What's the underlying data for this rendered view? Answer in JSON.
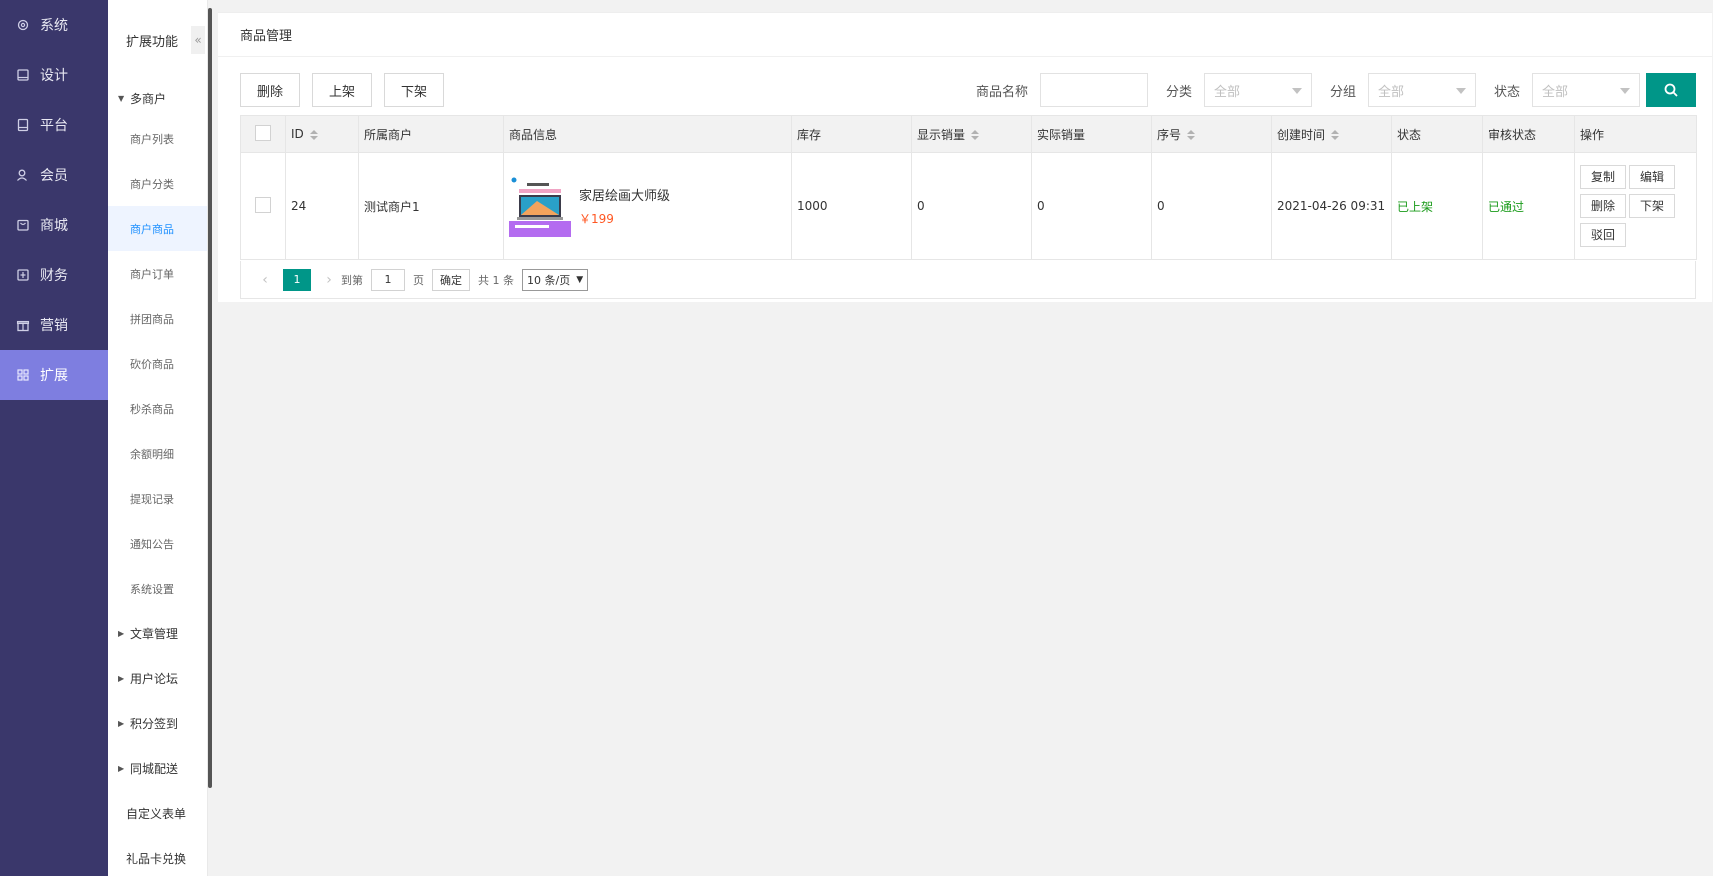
{
  "nav": {
    "items": [
      {
        "label": "系统",
        "icon": "gear-icon"
      },
      {
        "label": "设计",
        "icon": "monitor-icon"
      },
      {
        "label": "平台",
        "icon": "tablet-icon"
      },
      {
        "label": "会员",
        "icon": "user-icon"
      },
      {
        "label": "商城",
        "icon": "shop-icon"
      },
      {
        "label": "财务",
        "icon": "finance-icon"
      },
      {
        "label": "营销",
        "icon": "gift-icon"
      },
      {
        "label": "扩展",
        "icon": "grid-icon"
      }
    ],
    "active": "扩展"
  },
  "submenu": {
    "title": "扩展功能",
    "collapse_glyph": "«",
    "group_merchant": "多商户",
    "merchant_items": [
      "商户列表",
      "商户分类",
      "商户商品",
      "商户订单",
      "拼团商品",
      "砍价商品",
      "秒杀商品",
      "余额明细",
      "提现记录",
      "通知公告",
      "系统设置"
    ],
    "active_item": "商户商品",
    "groups": [
      "文章管理",
      "用户论坛",
      "积分签到",
      "同城配送"
    ],
    "plain_items": [
      "自定义表单",
      "礼品卡兑换"
    ]
  },
  "page": {
    "title": "商品管理"
  },
  "toolbar": {
    "delete_label": "删除",
    "shelve_label": "上架",
    "unshelve_label": "下架"
  },
  "filters": {
    "name_label": "商品名称",
    "name_value": "",
    "category_label": "分类",
    "category_value": "全部",
    "group_label": "分组",
    "group_value": "全部",
    "status_label": "状态",
    "status_value": "全部"
  },
  "table": {
    "headers": [
      "ID",
      "所属商户",
      "商品信息",
      "库存",
      "显示销量",
      "实际销量",
      "序号",
      "创建时间",
      "状态",
      "审核状态",
      "操作"
    ],
    "rows": [
      {
        "id": "24",
        "merchant": "测试商户1",
        "goods_name": "家居绘画大师级",
        "price": "￥199",
        "stock": "1000",
        "display_sales": "0",
        "actual_sales": "0",
        "sort": "0",
        "created": "2021-04-26 09:31",
        "status": "已上架",
        "audit": "已通过",
        "ops": [
          "复制",
          "编辑",
          "删除",
          "下架",
          "驳回"
        ]
      }
    ]
  },
  "pager": {
    "current": "1",
    "goto_label": "到第",
    "goto_value": "1",
    "page_unit": "页",
    "ok_label": "确定",
    "total": "共 1 条",
    "page_size": "10 条/页"
  },
  "colors": {
    "nav_bg": "#3a376b",
    "nav_active": "#7e7ee0",
    "primary": "#009688",
    "success": "#1a9b1a",
    "price": "#ff5722"
  }
}
